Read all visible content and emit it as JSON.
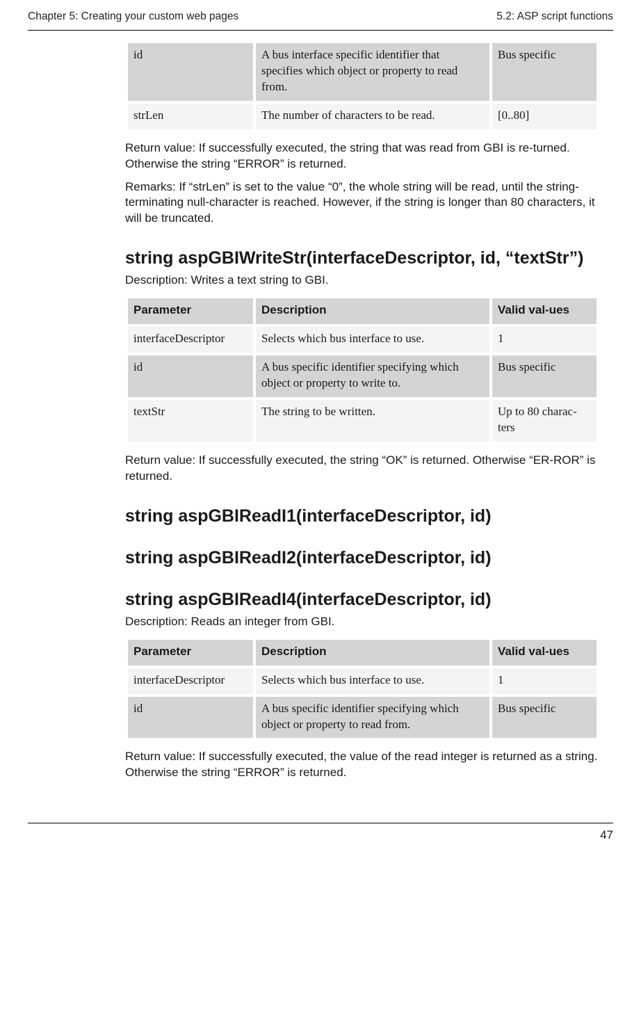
{
  "header": {
    "left": "Chapter 5: Creating your custom web pages",
    "right": "5.2: ASP script functions"
  },
  "table1": {
    "rows": [
      {
        "param": "id",
        "desc": "A bus interface specific identifier that specifies which object or property to read from.",
        "valid": "Bus specific",
        "shade": "dark"
      },
      {
        "param": "strLen",
        "desc": "The number of characters to be read.",
        "valid": "[0..80]",
        "shade": "light"
      }
    ]
  },
  "para1a": "Return value: If successfully executed, the string that was read from GBI is re-turned. Otherwise the string “ERROR” is returned.",
  "para1b": "Remarks: If “strLen” is set to the value “0”, the whole string will be read, until the string-terminating null-character is reached. However, if the string is longer than 80 characters, it will be truncated.",
  "h2a": "string aspGBIWriteStr(interfaceDescriptor, id, “textStr”)",
  "desc2": "Description: Writes a text string to GBI.",
  "table2": {
    "head": {
      "param": "Parameter",
      "desc": "Description",
      "valid": "Valid val-ues"
    },
    "rows": [
      {
        "param": "interfaceDescriptor",
        "desc": "Selects which bus interface to use.",
        "valid": "1",
        "shade": "light"
      },
      {
        "param": "id",
        "desc": "A bus specific identifier specifying which object or property to write to.",
        "valid": "Bus specific",
        "shade": "dark"
      },
      {
        "param": "textStr",
        "desc": "The string to be written.",
        "valid": "Up to 80 charac-ters",
        "shade": "light"
      }
    ]
  },
  "para2": "Return value: If successfully executed, the string “OK” is returned. Otherwise “ER-ROR” is returned.",
  "h2b": "string aspGBIReadI1(interfaceDescriptor, id)",
  "h2c": "string aspGBIReadI2(interfaceDescriptor, id)",
  "h2d": "string aspGBIReadI4(interfaceDescriptor, id)",
  "desc3": "Description: Reads an integer from GBI.",
  "table3": {
    "head": {
      "param": "Parameter",
      "desc": "Description",
      "valid": "Valid val-ues"
    },
    "rows": [
      {
        "param": "interfaceDescriptor",
        "desc": "Selects which bus interface to use.",
        "valid": "1",
        "shade": "light"
      },
      {
        "param": "id",
        "desc": "A bus specific identifier specifying which object or property to read from.",
        "valid": "Bus specific",
        "shade": "dark"
      }
    ]
  },
  "para3": "Return value: If successfully executed, the value of the read integer is returned as a string. Otherwise the string “ERROR” is returned.",
  "pagenum": "47"
}
